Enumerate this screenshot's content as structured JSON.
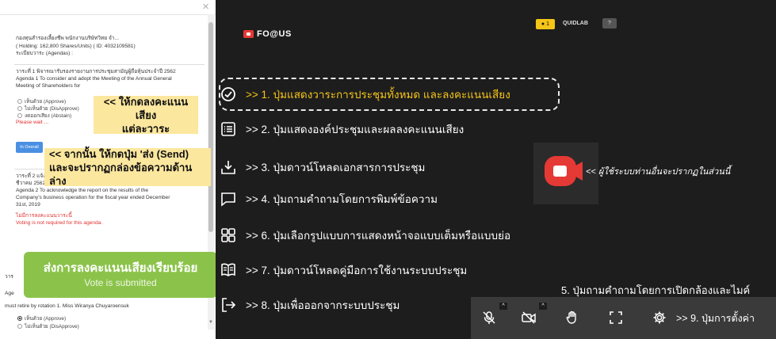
{
  "left_panel": {
    "close": "×",
    "company": "กองทุนสำรองเลี้ยงชีพ พนักงานบริษัทวิทย จำ...",
    "holding": "( Holding: 162,800 Shares/Units) ( ID: 4032109581)",
    "agenda_header": "ระเบียบวาระ (Agendas) :",
    "agenda1_th": "วาระที่ 1 พิจารณารับรองรายงานการประชุมสามัญผู้ถือหุ้นประจำปี 2562",
    "agenda1_en_1": "Agenda 1 To consider and adopt the Meeting of the Annual General",
    "agenda1_en_2": "Meeting of Shareholders for",
    "opt_approve": "เห็นด้วย (Approve)",
    "opt_disapprove": "ไม่เห็นด้วย (DisApprove)",
    "opt_abstain": "งดออกเสียง (Abstain)",
    "please_wait": "Please wait ...",
    "send_button": "In Overall",
    "agenda2_th_1": "วาระที่ 2 แจ้ง",
    "agenda2_th_2": "ชีวาคม 2562",
    "agenda2_en_1": "Agenda 2 To acknowledge the report on the results of the",
    "agenda2_en_2": "Company's business operation for the fiscal year ended December",
    "agenda2_en_3": "31st, 2019",
    "no_vote_th": "ไม่มีการลงคะแนนวาระนี้",
    "no_vote_en": "Voting is not required for this agenda.",
    "agenda3_th": "วาร",
    "agenda3_mid": "Age",
    "agenda3_en": "must retire by rotation 1. Miss Wiranya Chuyaroensuk",
    "agenda3_approve": "เห็นด้วย (Approve)",
    "agenda3_disapprove": "ไม่เห็นด้วย (DisApprove)",
    "tip_vote_1": "<< ให้กดลงคะแนนเสียง",
    "tip_vote_2": "แต่ละวาระ",
    "tip_send_1": "<< จากนั้น ให้กดปุ่ม 'ส่ง (Send)",
    "tip_send_2": "และจะปรากฏกล่องข้อความด้านล่าง",
    "submitted_th": "ส่งการลงคะแนนเสียงเรียบร้อย",
    "submitted_en": "Vote is submitted"
  },
  "header": {
    "logo_text": "FO@US",
    "user_badge": "1",
    "user_name": "QUIDLAB",
    "user_button": "?"
  },
  "menu": [
    {
      "icon": "check-circle-icon",
      "label": ">> 1.  ปุ่มแสดงวาระการประชุมทั้งหมด และลงคะแนนเสียง"
    },
    {
      "icon": "list-icon",
      "label": ">> 2.  ปุ่มแสดงองค์ประชุมและผลลงคะแนนเสียง"
    },
    {
      "icon": "download-icon",
      "label": ">> 3.  ปุ่มดาวน์โหลดเอกสารการประชุม"
    },
    {
      "icon": "chat-icon",
      "label": ">> 4.  ปุ่มถามคำถามโดยการพิมพ์ข้อความ"
    },
    {
      "icon": "layout-grid-icon",
      "label": ">> 6.  ปุ่มเลือกรูปแบบการแสดงหน้าจอแบบเต็มหรือแบบย่อ"
    },
    {
      "icon": "manual-book-icon",
      "label": ">> 7.  ปุ่มดาวน์โหลดคู่มือการใช้งานระบบประชุม"
    },
    {
      "icon": "exit-icon",
      "label": ">> 8.  ปุ่มเพื่อออกจากระบบประชุม"
    }
  ],
  "camera_note": "<< ผู้ใช้ระบบท่านอื่นจะปรากฏในส่วนนี้",
  "controls": {
    "caption": "5. ปุ่มถามคำถามโดยการเปิดกล้องและไมค์",
    "settings_label": ">> 9. ปุ่มการตั้งค่า",
    "caret": "^"
  },
  "colors": {
    "dark_bg": "#1d1d1d",
    "highlight_text": "#f5c518",
    "tooltip_bg": "#fce79f",
    "success_green": "#8bc34a",
    "brand_red": "#e53935"
  }
}
